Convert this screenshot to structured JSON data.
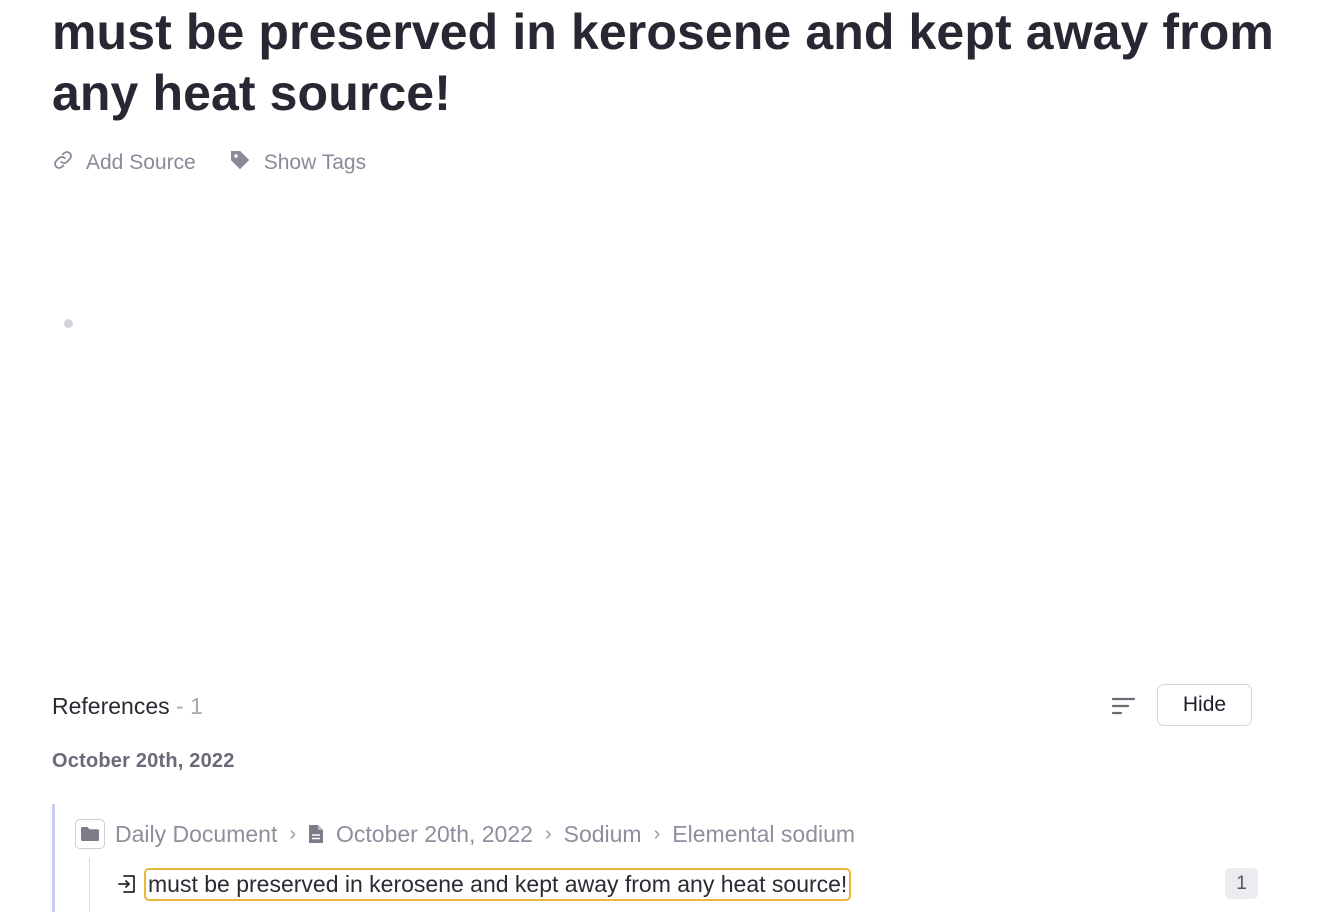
{
  "page": {
    "title": "must be preserved in kerosene and kept away from any heat source!"
  },
  "meta": {
    "add_source_label": "Add Source",
    "show_tags_label": "Show Tags"
  },
  "references": {
    "label": "References",
    "count_text": " - 1",
    "hide_label": "Hide",
    "groups": [
      {
        "date": "October 20th, 2022",
        "breadcrumb": [
          "Daily Document",
          "October 20th, 2022",
          "Sodium",
          "Elemental sodium"
        ],
        "block_text": "must be preserved in kerosene and kept away from any heat source!",
        "ref_count": "1"
      }
    ]
  },
  "colors": {
    "highlight_border": "#e8b63a",
    "ref_bar": "#c7cdea",
    "muted_text": "#8f8e9d"
  },
  "icons": {
    "add_source": "link-icon",
    "show_tags": "tag-icon",
    "sort": "sort-icon",
    "folder": "folder-icon",
    "document": "document-icon",
    "block_ref": "enter-icon"
  }
}
